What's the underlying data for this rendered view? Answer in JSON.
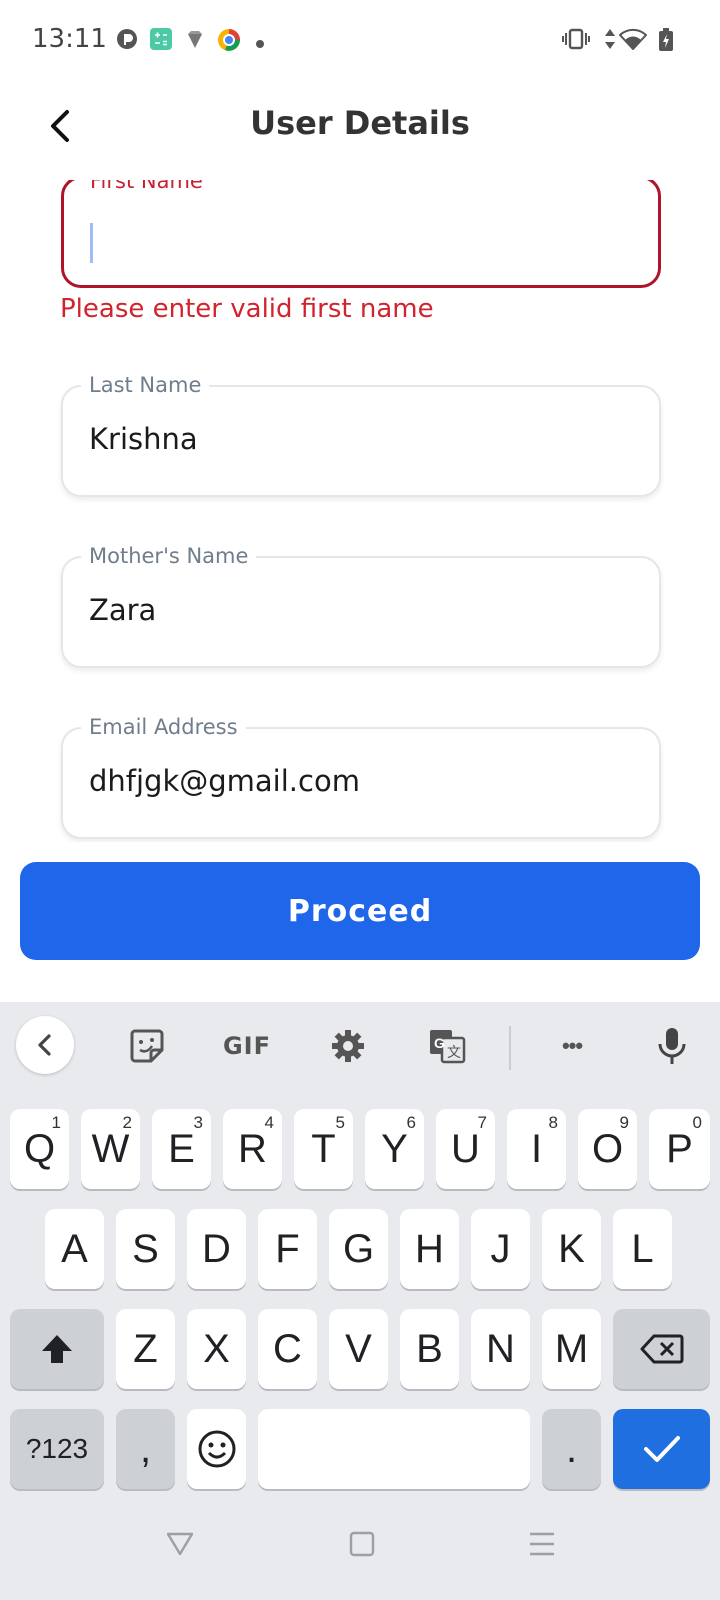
{
  "status_bar": {
    "time": "13:11",
    "left_icons": [
      "app-icon-1",
      "calculator-icon",
      "diamond-icon",
      "chrome-like-icon",
      "dot-icon"
    ],
    "right_icons": [
      "vibrate-icon",
      "data-arrows-icon",
      "wifi-icon",
      "battery-icon"
    ]
  },
  "header": {
    "title": "User Details",
    "back_icon": "chevron-left-icon"
  },
  "form": {
    "first_name": {
      "label": "First Name",
      "value": "",
      "error": "Please enter valid first name"
    },
    "last_name": {
      "label": "Last Name",
      "value": "Krishna"
    },
    "mothers_name": {
      "label": "Mother's Name",
      "value": "Zara"
    },
    "email": {
      "label": "Email Address",
      "value": "dhfjgk@gmail.com"
    }
  },
  "proceed_label": "Proceed",
  "keyboard": {
    "toolbar": {
      "back_icon": "chevron-left-icon",
      "sticker_icon": "sticker-icon",
      "gif_label": "GIF",
      "settings_icon": "gear-icon",
      "translate_icon": "translate-icon",
      "more_label": "•••",
      "mic_icon": "microphone-icon"
    },
    "row1": [
      {
        "key": "Q",
        "hint": "1"
      },
      {
        "key": "W",
        "hint": "2"
      },
      {
        "key": "E",
        "hint": "3"
      },
      {
        "key": "R",
        "hint": "4"
      },
      {
        "key": "T",
        "hint": "5"
      },
      {
        "key": "Y",
        "hint": "6"
      },
      {
        "key": "U",
        "hint": "7"
      },
      {
        "key": "I",
        "hint": "8"
      },
      {
        "key": "O",
        "hint": "9"
      },
      {
        "key": "P",
        "hint": "0"
      }
    ],
    "row2": [
      "A",
      "S",
      "D",
      "F",
      "G",
      "H",
      "J",
      "K",
      "L"
    ],
    "row3": [
      "Z",
      "X",
      "C",
      "V",
      "B",
      "N",
      "M"
    ],
    "symbols_label": "?123",
    "comma_label": ",",
    "period_label": ".",
    "emoji_icon": "smiley-icon",
    "shift_icon": "shift-arrow-icon",
    "backspace_icon": "backspace-icon",
    "enter_icon": "checkmark-icon",
    "accent_color": "#1f6fe0"
  },
  "nav_bar": {
    "back_icon": "triangle-back-icon",
    "home_icon": "square-home-icon",
    "recents_icon": "menu-lines-icon"
  },
  "colors": {
    "primary": "#1f66ea",
    "error": "#d0242e",
    "error_border": "#b0142a"
  }
}
